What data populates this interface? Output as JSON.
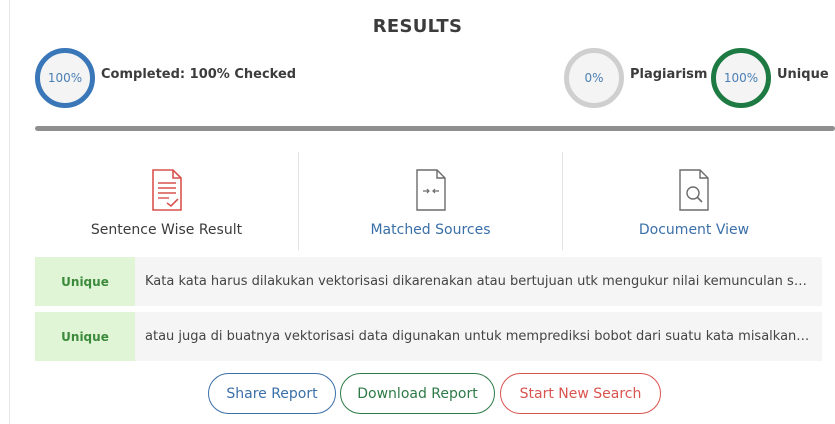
{
  "header": {
    "title": "RESULTS"
  },
  "stats": {
    "completed": {
      "value": "100%",
      "label": "Completed: 100% Checked"
    },
    "plagiarism": {
      "value": "0%",
      "label": "Plagiarism"
    },
    "unique": {
      "value": "100%",
      "label": "Unique"
    },
    "progress_fraction": 1.0
  },
  "views": [
    {
      "label": "Sentence Wise Result",
      "icon": "document-check-icon",
      "active": true
    },
    {
      "label": "Matched Sources",
      "icon": "document-compare-icon",
      "active": false
    },
    {
      "label": "Document View",
      "icon": "document-search-icon",
      "active": false
    }
  ],
  "results": [
    {
      "status": "Unique",
      "text": "Kata kata harus dilakukan vektorisasi dikarenakan atau bertujuan utk mengukur nilai kemunculan suatu kata"
    },
    {
      "status": "Unique",
      "text": "atau juga di buatnya vektorisasi data digunakan untuk memprediksi bobot dari suatu kata misalkan ayam"
    }
  ],
  "actions": {
    "share": "Share Report",
    "download": "Download Report",
    "new_search": "Start New Search"
  },
  "colors": {
    "completed_ring": "#3a77b8",
    "plagiarism_ring": "#cfcfcf",
    "unique_ring": "#1e7a43",
    "unique_badge_bg": "#dff5d6",
    "new_search": "#d9534f"
  }
}
